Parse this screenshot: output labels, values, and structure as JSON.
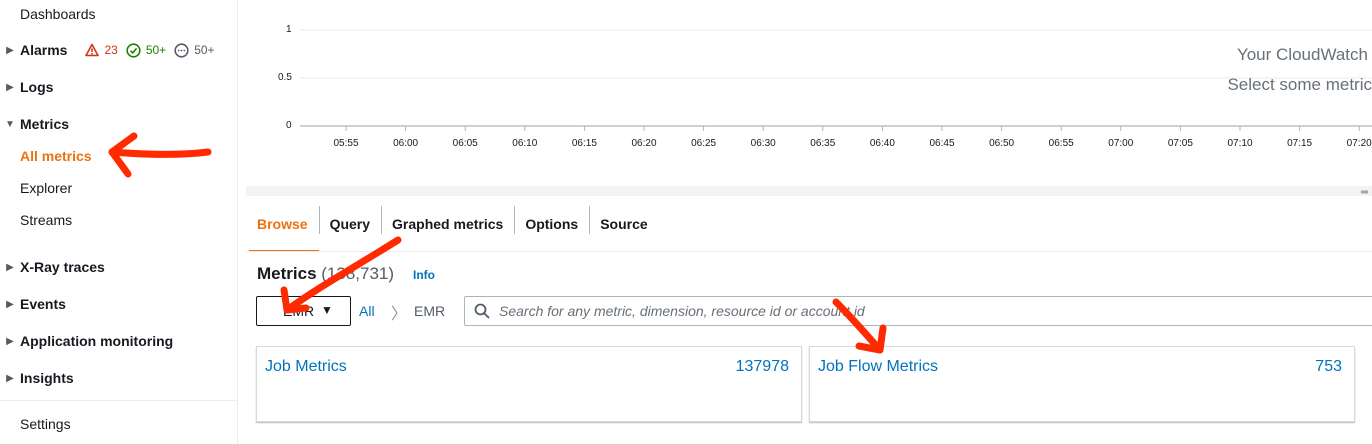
{
  "sidebar": {
    "dashboards": "Dashboards",
    "alarms": {
      "label": "Alarms",
      "in_alarm": "23",
      "ok": "50+",
      "insufficient": "50+"
    },
    "logs": "Logs",
    "metrics": "Metrics",
    "metrics_items": [
      "All metrics",
      "Explorer",
      "Streams"
    ],
    "xray": "X-Ray traces",
    "events": "Events",
    "app_monitoring": "Application monitoring",
    "insights": "Insights",
    "settings": "Settings"
  },
  "chart": {
    "yticks": [
      "1",
      "0.5",
      "0"
    ],
    "xticks": [
      "05:55",
      "06:00",
      "06:05",
      "06:10",
      "06:15",
      "06:20",
      "06:25",
      "06:30",
      "06:35",
      "06:40",
      "06:45",
      "06:50",
      "06:55",
      "07:00",
      "07:05",
      "07:10",
      "07:15",
      "07:20"
    ],
    "empty_line1": "Your CloudWatch",
    "empty_line2": "Select some metric"
  },
  "tabs": [
    "Browse",
    "Query",
    "Graphed metrics",
    "Options",
    "Source"
  ],
  "metrics_header": {
    "title": "Metrics",
    "count": "(138,731)",
    "info": "Info"
  },
  "filter": {
    "namespace": "EMR",
    "crumb_all": "All",
    "crumb_sep": "〉",
    "crumb_current": "EMR",
    "search_placeholder": "Search for any metric, dimension, resource id or account id"
  },
  "cards": [
    {
      "title": "Job Metrics",
      "count": "137978"
    },
    {
      "title": "Job Flow Metrics",
      "count": "753"
    }
  ],
  "colors": {
    "accent": "#ec7211",
    "link": "#0073bb",
    "annotation_arrow": "#ff2a00"
  }
}
